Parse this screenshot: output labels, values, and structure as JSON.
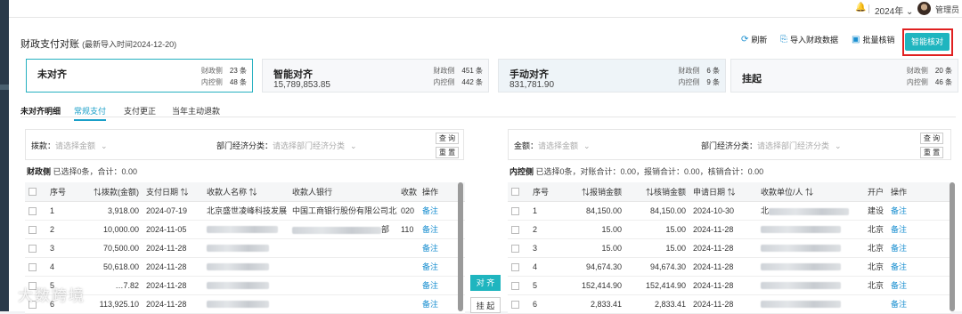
{
  "header": {
    "year": "2024年",
    "user": "管理员",
    "bell_icon": "bell-icon",
    "avatar_icon": "user-avatar"
  },
  "page": {
    "title": "财政支付对账",
    "subtitle": "(最新导入时间2024-12-20)"
  },
  "toolbar": {
    "refresh": "刷新",
    "import": "导入财政数据",
    "batch": "批量核销",
    "smart": "智能核对"
  },
  "cards": [
    {
      "title": "未对齐",
      "value": "",
      "r1_label": "财政侧",
      "r1_value": "23 条",
      "r2_label": "内控侧",
      "r2_value": "48 条"
    },
    {
      "title": "智能对齐",
      "value": "15,789,853.85",
      "r1_label": "财政侧",
      "r1_value": "451 条",
      "r2_label": "内控侧",
      "r2_value": "442 条"
    },
    {
      "title": "手动对齐",
      "value": "831,781.90",
      "r1_label": "财政侧",
      "r1_value": "6 条",
      "r2_label": "内控侧",
      "r2_value": "9 条"
    },
    {
      "title": "挂起",
      "value": "",
      "r1_label": "财政侧",
      "r1_value": "20 条",
      "r2_label": "内控侧",
      "r2_value": "46 条"
    }
  ],
  "tabs": {
    "label": "未对齐明细",
    "items": [
      "常规支付",
      "支付更正",
      "当年主动退款"
    ]
  },
  "left_filter": {
    "amount_label": "拨款：",
    "amount_placeholder": "请选择金额",
    "category_label": "部门经济分类：",
    "category_placeholder": "请选择部门经济分类",
    "query": "查 询",
    "reset": "重 置"
  },
  "right_filter": {
    "amount_label": "金额：",
    "amount_placeholder": "请选择金额",
    "category_label": "部门经济分类：",
    "category_placeholder": "请选择部门经济分类",
    "query": "查 询",
    "reset": "重 置"
  },
  "left_summary": {
    "label": "财政侧",
    "text": "已选择0条，合计：0.00"
  },
  "right_summary": {
    "label": "内控侧",
    "text": "已选择0条，对账合计：0.00，报销合计：0.00，核销合计：0.00"
  },
  "left_table": {
    "headers": [
      "序号",
      "⇅拨款(金额)",
      "支付日期 ⇅",
      "收款人名称 ⇅",
      "收款人银行",
      "收款",
      "操作"
    ],
    "rows": [
      {
        "no": "1",
        "amount": "3,918.00",
        "date": "2024-07-19",
        "payee": "北京盛世凌峰科技发展",
        "bank": "中国工商银行股份有限公司北京",
        "acct": "020",
        "op": "备注"
      },
      {
        "no": "2",
        "amount": "10,000.00",
        "date": "2024-11-05",
        "payee": "",
        "bank": "部",
        "acct": "110",
        "op": "备注"
      },
      {
        "no": "3",
        "amount": "70,500.00",
        "date": "2024-11-28",
        "payee": "",
        "bank": "",
        "acct": "",
        "op": "备注"
      },
      {
        "no": "4",
        "amount": "50,618.00",
        "date": "2024-11-28",
        "payee": "",
        "bank": "",
        "acct": "",
        "op": "备注"
      },
      {
        "no": "5",
        "amount": "…7.82",
        "date": "2024-11-28",
        "payee": "",
        "bank": "",
        "acct": "",
        "op": "备注"
      },
      {
        "no": "6",
        "amount": "113,925.10",
        "date": "2024-11-28",
        "payee": "",
        "bank": "",
        "acct": "",
        "op": "备注"
      }
    ]
  },
  "right_table": {
    "headers": [
      "序号",
      "⇅报销金额",
      "⇅核销金额",
      "申请日期 ⇅",
      "收款单位/人 ⇅",
      "开户",
      "操作"
    ],
    "rows": [
      {
        "no": "1",
        "reimb": "84,150.00",
        "verify": "84,150.00",
        "date": "2024-10-30",
        "payee": "北",
        "bank": "建设",
        "op": "备注"
      },
      {
        "no": "2",
        "reimb": "15.00",
        "verify": "15.00",
        "date": "2024-11-28",
        "payee": "",
        "bank": "北京",
        "op": "备注"
      },
      {
        "no": "3",
        "reimb": "15.00",
        "verify": "15.00",
        "date": "2024-11-28",
        "payee": "",
        "bank": "北京",
        "op": "备注"
      },
      {
        "no": "4",
        "reimb": "94,674.30",
        "verify": "94,674.30",
        "date": "2024-11-28",
        "payee": "",
        "bank": "北京",
        "op": "备注"
      },
      {
        "no": "5",
        "reimb": "152,414.90",
        "verify": "152,414.90",
        "date": "2024-11-28",
        "payee": "",
        "bank": "北京",
        "op": "备注"
      },
      {
        "no": "6",
        "reimb": "2,833.41",
        "verify": "2,833.41",
        "date": "2024-11-28",
        "payee": "",
        "bank": "",
        "op": "备注"
      }
    ]
  },
  "middle": {
    "align": "对 齐",
    "suspend": "挂 起"
  },
  "watermark": "大数跨境",
  "colors": {
    "accent": "#1fb5bf",
    "link": "#1a8fd0",
    "highlight": "#e02020"
  }
}
